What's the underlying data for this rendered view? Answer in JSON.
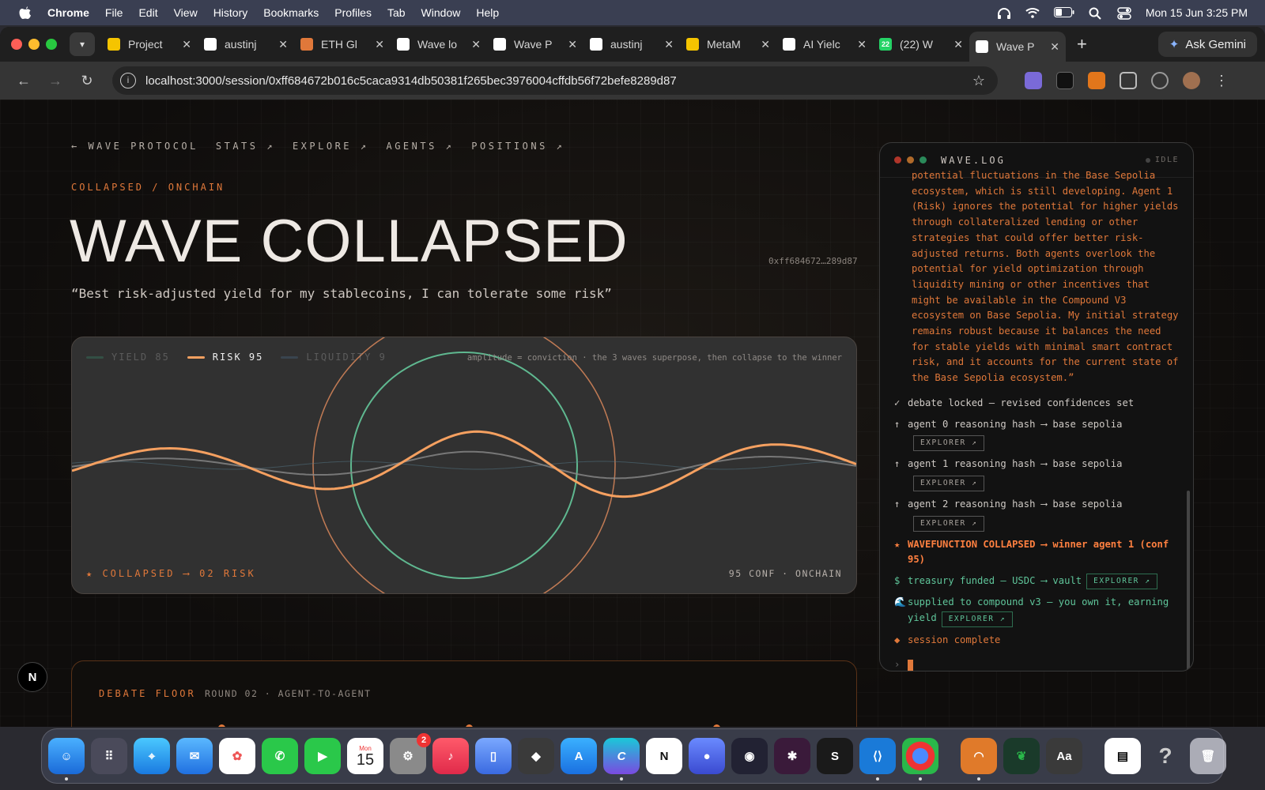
{
  "menubar": {
    "app": "Chrome",
    "items": [
      "File",
      "Edit",
      "View",
      "History",
      "Bookmarks",
      "Profiles",
      "Tab",
      "Window",
      "Help"
    ],
    "clock": "Mon 15 Jun  3:25 PM"
  },
  "tabs": [
    {
      "title": "Project",
      "favicon_color": "#f5c400"
    },
    {
      "title": "austinj",
      "favicon_color": "#ffffff"
    },
    {
      "title": "ETH Gl",
      "favicon_color": "#e0783a"
    },
    {
      "title": "Wave lo",
      "favicon_color": "#ffffff"
    },
    {
      "title": "Wave P",
      "favicon_color": "#ffffff"
    },
    {
      "title": "austinj",
      "favicon_color": "#ffffff"
    },
    {
      "title": "MetaM",
      "favicon_color": "#f5c400"
    },
    {
      "title": "AI Yielc",
      "favicon_color": "#ffffff"
    },
    {
      "title": "(22) W",
      "favicon_color": "#25d366",
      "badge": "22"
    },
    {
      "title": "Wave P",
      "favicon_color": "#ffffff",
      "active": true
    }
  ],
  "ask_gemini": "Ask Gemini",
  "url": "localhost:3000/session/0xff684672b016c5caca9314db50381f265bec3976004cffdb56f72befe8289d87",
  "page": {
    "nav": [
      "← WAVE PROTOCOL",
      "STATS ↗",
      "EXPLORE ↗",
      "AGENTS ↗",
      "POSITIONS ↗"
    ],
    "kicker": "COLLAPSED / ONCHAIN",
    "title": "WAVE COLLAPSED",
    "session_hash": "0xff684672…289d87",
    "quote": "“Best risk-adjusted yield for my stablecoins, I can tolerate some risk”",
    "wave": {
      "legend": [
        {
          "label": "YIELD 85",
          "color": "#3a8a6a",
          "dim": true
        },
        {
          "label": "RISK 95",
          "color": "#f5a060",
          "dim": false
        },
        {
          "label": "LIQUIDITY 9",
          "color": "#4a6a8a",
          "dim": true
        }
      ],
      "caption": "amplitude = conviction · the 3 waves superpose, then collapse to the winner",
      "footer_left": "★ COLLAPSED ⟶ 02 RISK",
      "footer_right": "95 CONF · ONCHAIN"
    },
    "debate": {
      "heading": "DEBATE FLOOR",
      "sub": "ROUND 02 · AGENT-TO-AGENT"
    }
  },
  "log": {
    "title": "WAVE.LOG",
    "status": "IDLE",
    "paragraph": "potential fluctuations in the Base Sepolia ecosystem, which is still developing. Agent 1 (Risk) ignores the potential for higher yields through collateralized lending or other strategies that could offer better risk-adjusted returns. Both agents overlook the potential for yield optimization through liquidity mining or other incentives that might be available in the Compound V3 ecosystem on Base Sepolia. My initial strategy remains robust because it balances the need for stable yields with minimal smart contract risk, and it accounts for the current state of the Base Sepolia ecosystem.”",
    "debate_locked": "debate locked — revised confidences set",
    "agent0": "agent 0 reasoning hash ⟶ base sepolia",
    "agent1": "agent 1 reasoning hash ⟶ base sepolia",
    "agent2": "agent 2 reasoning hash ⟶ base sepolia",
    "explorer": "EXPLORER ↗",
    "collapsed": "WAVEFUNCTION COLLAPSED ⟶ winner agent 1 (conf 95)",
    "treasury": "treasury funded — USDC ⟶ vault",
    "supplied": "supplied to compound v3 — you own it, earning yield",
    "complete": "session complete",
    "prompt": "›"
  },
  "dock": {
    "calendar_month": "Mon",
    "calendar_day": "15",
    "settings_badge": "2"
  }
}
